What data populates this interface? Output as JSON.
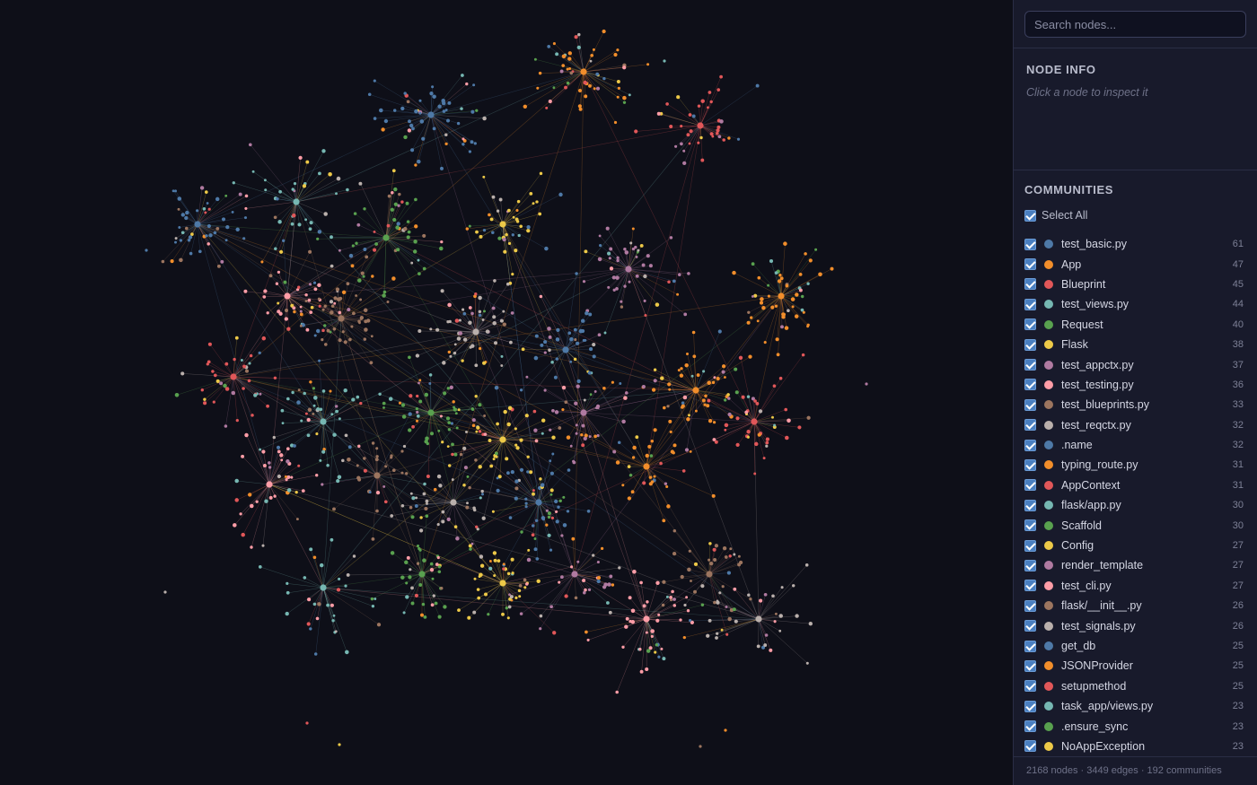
{
  "colors": {
    "background": "#0e0f18",
    "sidebar": "#181a2b",
    "palette": [
      "#4e79a7",
      "#f28e2b",
      "#e15759",
      "#76b7b2",
      "#59a14f",
      "#edc948",
      "#b07aa1",
      "#ff9da7",
      "#9c755f",
      "#bab0ac"
    ]
  },
  "search": {
    "placeholder": "Search nodes..."
  },
  "node_info": {
    "title": "NODE INFO",
    "hint": "Click a node to inspect it"
  },
  "communities": {
    "title": "COMMUNITIES",
    "select_all_label": "Select All",
    "items": [
      {
        "name": "test_basic.py",
        "count": "61",
        "color": "#4e79a7"
      },
      {
        "name": "App",
        "count": "47",
        "color": "#f28e2b"
      },
      {
        "name": "Blueprint",
        "count": "45",
        "color": "#e15759"
      },
      {
        "name": "test_views.py",
        "count": "44",
        "color": "#76b7b2"
      },
      {
        "name": "Request",
        "count": "40",
        "color": "#59a14f"
      },
      {
        "name": "Flask",
        "count": "38",
        "color": "#edc948"
      },
      {
        "name": "test_appctx.py",
        "count": "37",
        "color": "#b07aa1"
      },
      {
        "name": "test_testing.py",
        "count": "36",
        "color": "#ff9da7"
      },
      {
        "name": "test_blueprints.py",
        "count": "33",
        "color": "#9c755f"
      },
      {
        "name": "test_reqctx.py",
        "count": "32",
        "color": "#bab0ac"
      },
      {
        "name": ".name",
        "count": "32",
        "color": "#4e79a7"
      },
      {
        "name": "typing_route.py",
        "count": "31",
        "color": "#f28e2b"
      },
      {
        "name": "AppContext",
        "count": "31",
        "color": "#e15759"
      },
      {
        "name": "flask/app.py",
        "count": "30",
        "color": "#76b7b2"
      },
      {
        "name": "Scaffold",
        "count": "30",
        "color": "#59a14f"
      },
      {
        "name": "Config",
        "count": "27",
        "color": "#edc948"
      },
      {
        "name": "render_template",
        "count": "27",
        "color": "#b07aa1"
      },
      {
        "name": "test_cli.py",
        "count": "27",
        "color": "#ff9da7"
      },
      {
        "name": "flask/__init__.py",
        "count": "26",
        "color": "#9c755f"
      },
      {
        "name": "test_signals.py",
        "count": "26",
        "color": "#bab0ac"
      },
      {
        "name": "get_db",
        "count": "25",
        "color": "#4e79a7"
      },
      {
        "name": "JSONProvider",
        "count": "25",
        "color": "#f28e2b"
      },
      {
        "name": "setupmethod",
        "count": "25",
        "color": "#e15759"
      },
      {
        "name": "task_app/views.py",
        "count": "23",
        "color": "#76b7b2"
      },
      {
        "name": ".ensure_sync",
        "count": "23",
        "color": "#59a14f"
      },
      {
        "name": "NoAppException",
        "count": "23",
        "color": "#edc948"
      }
    ]
  },
  "footer": {
    "stats": "2168 nodes · 3449 edges · 192 communities"
  }
}
